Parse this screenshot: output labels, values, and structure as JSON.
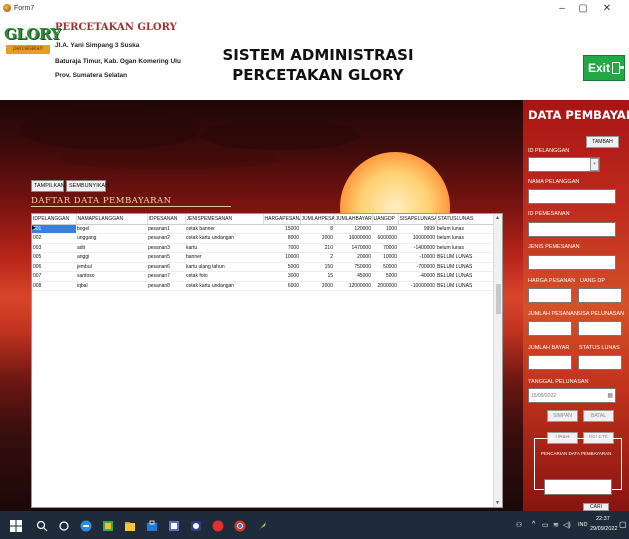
{
  "window": {
    "title": "Form7"
  },
  "header": {
    "logo_text": "GLORY",
    "logo_sub": "percetakan",
    "company": "PERCETAKAN GLORY",
    "address": [
      "Jl.A. Yani Simpang 3 Suska",
      "Baturaja Timur, Kab. Ogan Komering Ulu",
      "Prov. Sumatera Selatan"
    ],
    "title_line1": "SISTEM ADMINISTRASI",
    "title_line2": "PERCETAKAN GLORY",
    "exit_label": "Exit"
  },
  "toolbar": {
    "tampilkan": "TAMPILKAN",
    "sembunyikan": "SEMBUNYIKAN"
  },
  "list_title": "DAFTAR DATA PEMBAYARAN",
  "table": {
    "columns": [
      "IDPELANGGAN",
      "NAMAPELANGGAN",
      "IDPESANAN",
      "JENISPEMESANAN",
      "HARGAPESANAN",
      "JUMLAHPESANAN",
      "JUMLAHBAYAR",
      "UANGDP",
      "SISAPELUNASAN",
      "STATUSLUNAS"
    ],
    "rows": [
      [
        "001",
        "bogel",
        "pesanan1",
        "cetak banner",
        "15000",
        "8",
        "120000",
        "1000",
        "9999",
        "belum lunas"
      ],
      [
        "002",
        "unggang",
        "pesanan2",
        "cetak kartu undangan",
        "8000",
        "2000",
        "16000000",
        "6000000",
        "10000000",
        "belum lunas"
      ],
      [
        "003",
        "adit",
        "pesanan3",
        "kartu",
        "7000",
        "210",
        "1470000",
        "70000",
        "-1400000",
        "belum lunas"
      ],
      [
        "005",
        "anggi",
        "pesanan5",
        "banner",
        "10000",
        "2",
        "20000",
        "10000",
        "-10000",
        "BELUM LUNAS"
      ],
      [
        "006",
        "jembul",
        "pesanan6",
        "kartu ulang tahun",
        "5000",
        "150",
        "750000",
        "50000",
        "-700000",
        "BELUM LUNAS"
      ],
      [
        "007",
        "santoso",
        "pesanan7",
        "cetak foto",
        "3000",
        "15",
        "45000",
        "5000",
        "-40000",
        "BELUM LUNAS"
      ],
      [
        "008",
        "iqbal",
        "pesanan8",
        "cetak kartu undangan",
        "6000",
        "2000",
        "12000000",
        "2000000",
        "-10000000",
        "BELUM LUNAS"
      ]
    ]
  },
  "form": {
    "title": "DATA PEMBAYARAN",
    "tambah": "TAMBAH",
    "id_pelanggan": "ID PELANGGAN",
    "nama_pelanggan": "NAMA PELANGGAN",
    "id_pemesanan": "ID PEMESANAN",
    "jenis_pemesanan": "JENIS PEMESANAN",
    "harga_pesanan": "HARGA PESANAN",
    "uang_dp": "UANG DP",
    "jumlah_pesanan": "JUMLAH PESANAN",
    "sisa_pelunasan": "SISA PELUNASAN",
    "jumlah_bayar": "JUMLAH BAYAR",
    "status_lunas": "STATUS LUNAS",
    "tanggal_pelunasan": "TANGGAL PELUNASAN",
    "tanggal_value": "15/09/2022",
    "simpan": "SIMPAN",
    "batal": "BATAL",
    "ubah": "UBAH",
    "delete": "DELETE",
    "pencarian": "PENCARIAN DATA PEMBAYARAN",
    "cari": "CARI"
  },
  "taskbar": {
    "lang": "IND",
    "time": "22:37",
    "date": "29/09/2022"
  },
  "colors": {
    "exit": "#23a845",
    "selection": "#3a80d8",
    "taskbar": "#1f2a3a"
  }
}
